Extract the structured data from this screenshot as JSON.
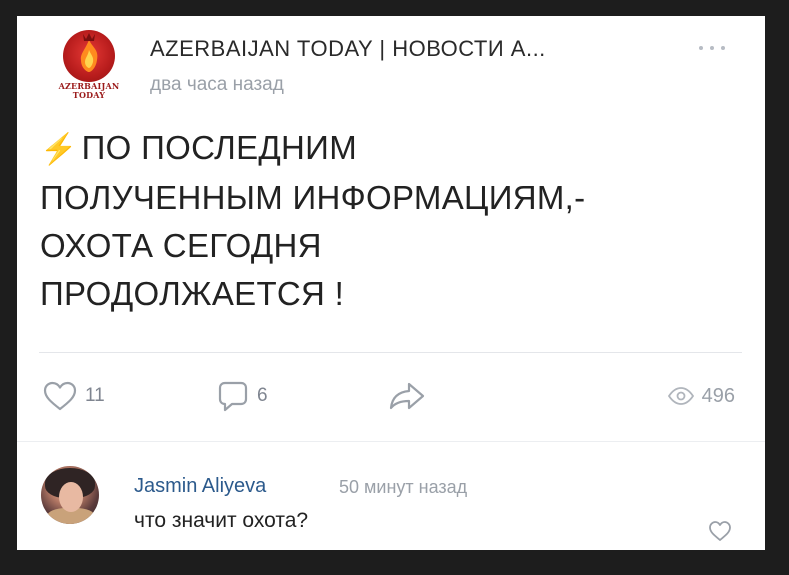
{
  "post": {
    "author": "AZERBAIJAN TODAY | НОВОСТИ А...",
    "time": "два часа назад",
    "logo": {
      "line1": "AZERBAIJAN",
      "line2": "TODAY"
    },
    "bolt_icon": "⚡",
    "text_lines": [
      "ПО ПОСЛЕДНИМ",
      "ПОЛУЧЕННЫМ ИНФОРМАЦИЯМ,-",
      "ОХОТА СЕГОДНЯ",
      "ПРОДОЛЖАЕТСЯ !"
    ],
    "likes": "11",
    "comments": "6",
    "views": "496"
  },
  "comment": {
    "author": "Jasmin Aliyeva",
    "time": "50 минут назад",
    "text": "что значит охота?"
  },
  "icons": {
    "more": "more-dots-icon",
    "like": "heart-icon",
    "comment": "comment-bubble-icon",
    "share": "share-arrow-icon",
    "views": "eye-icon"
  },
  "colors": {
    "author_link": "#2c5a8c",
    "muted": "#9aa0a8",
    "bolt": "#f4b400",
    "logo_red": "#b71c1c"
  }
}
